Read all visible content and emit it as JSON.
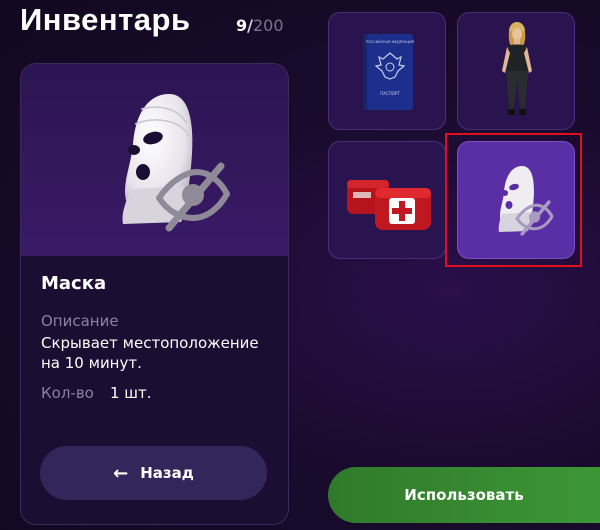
{
  "header": {
    "title": "Инвентарь",
    "count_current": "9",
    "count_separator": "/",
    "count_max": "200"
  },
  "detail": {
    "name": "Маска",
    "description_label": "Описание",
    "description": "Скрывает местоположение на 10 минут.",
    "quantity_label": "Кол-во",
    "quantity": "1 шт.",
    "preview_icon": "balaclava-mask-icon",
    "status_icon": "eye-off-icon"
  },
  "buttons": {
    "back_label": "Назад",
    "use_label": "Использовать"
  },
  "grid": {
    "slots": [
      {
        "item": "passport",
        "icon": "passport-icon",
        "cover_text_top": "РОССИЙСКАЯ ФЕДЕРАЦИЯ",
        "cover_text_bottom": "ПАСПОРТ"
      },
      {
        "item": "character-skin",
        "icon": "character-skin-icon"
      },
      {
        "item": "first-aid-kit",
        "icon": "first-aid-kit-icon"
      },
      {
        "item": "mask",
        "icon": "balaclava-mask-icon",
        "selected": true
      }
    ]
  },
  "colors": {
    "background": "#1a0b2e",
    "slot": "#2a1450",
    "slot_selected": "#5a2fa6",
    "use_button": "#3d9636",
    "highlight": "#e0101a"
  }
}
